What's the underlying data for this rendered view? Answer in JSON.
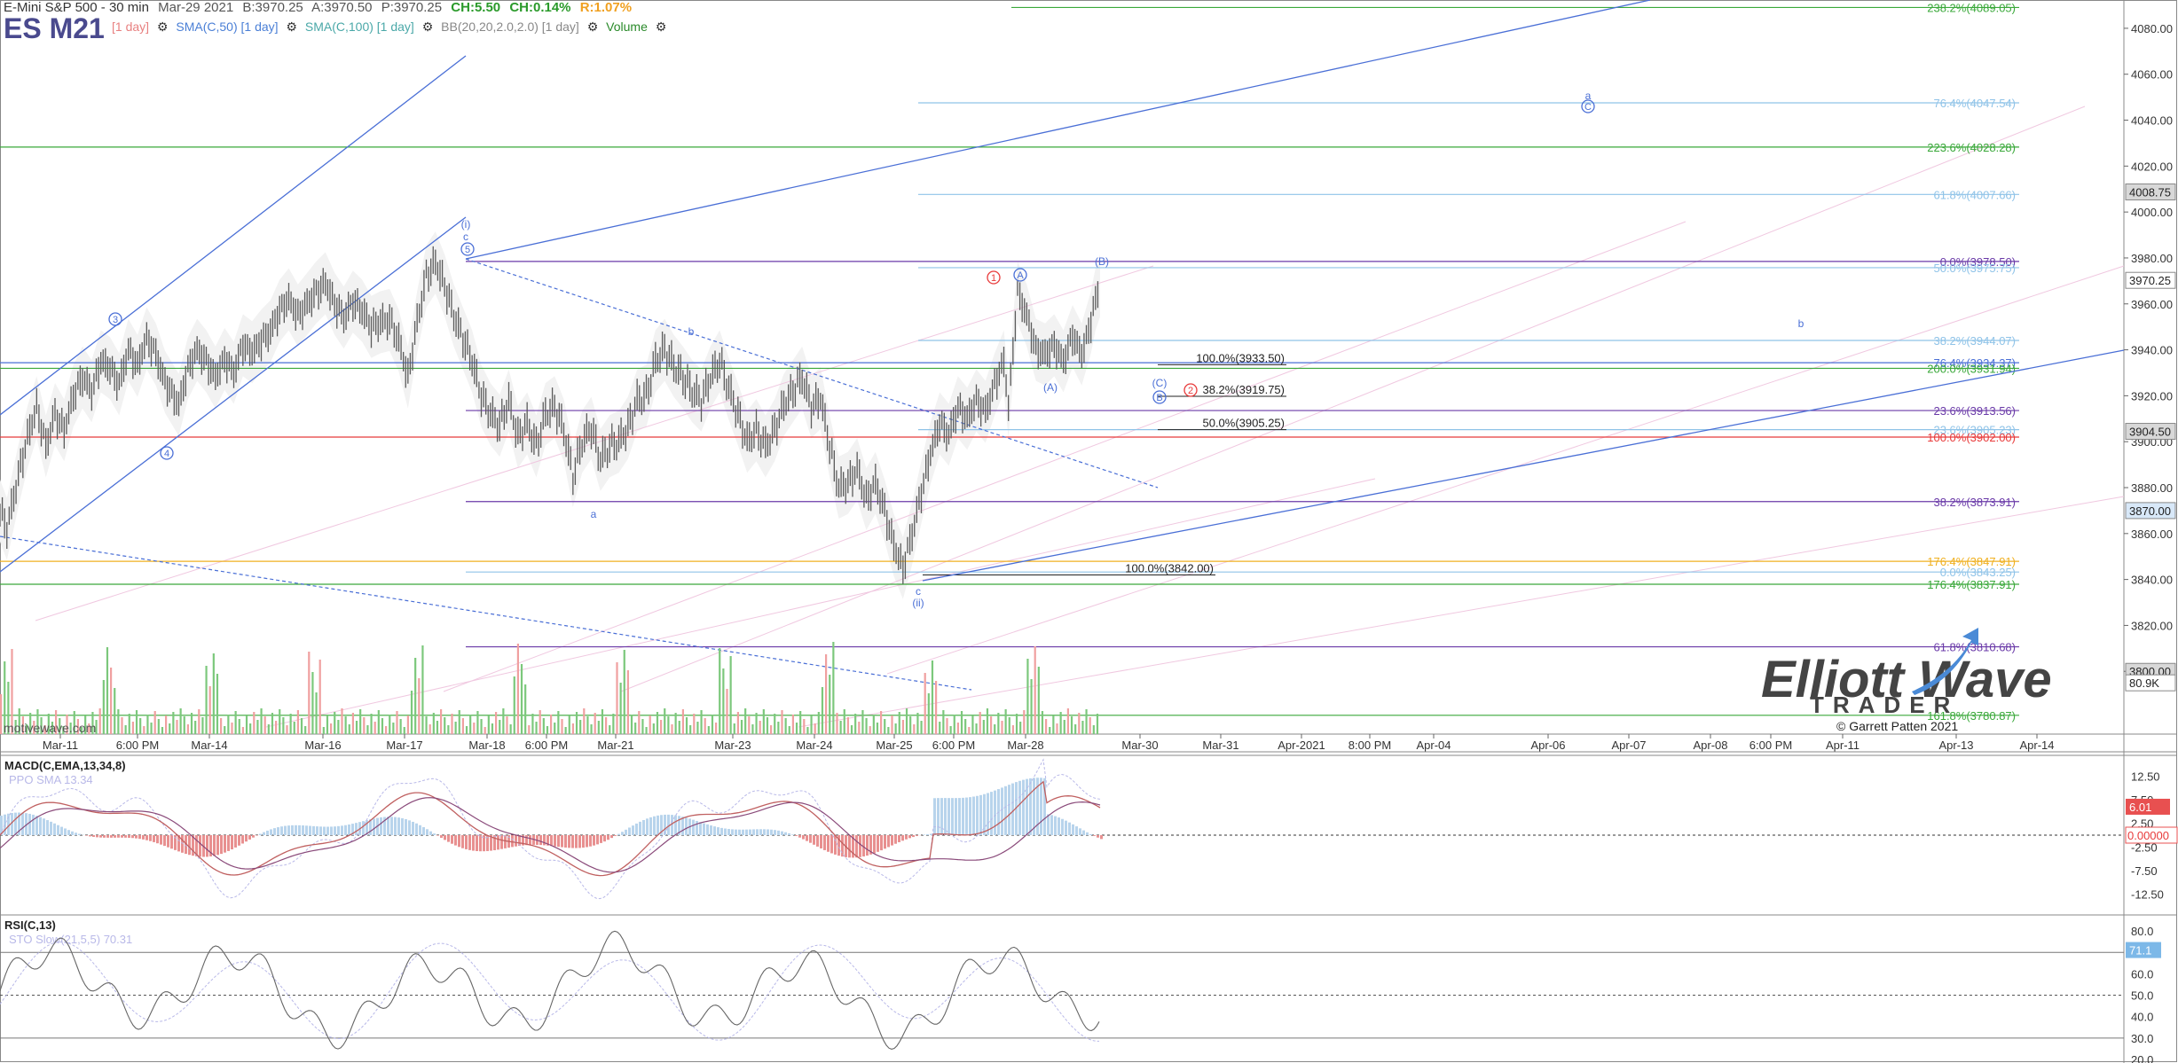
{
  "header": {
    "title": "E-Mini S&P 500 - 30 min",
    "symbol": "ES M21",
    "date": "Mar-29 2021",
    "bid": "B:3970.25",
    "ask": "A:3970.50",
    "price": "P:3970.25",
    "change": "CH:5.50",
    "change_pct": "CH:0.14%",
    "range": "R:1.07%",
    "indicators": [
      {
        "label": "SMA(C,50) [1 day]",
        "color": "#4a7fd6"
      },
      {
        "label": "SMA(C,100) [1 day]",
        "color": "#4aa8a8"
      },
      {
        "label": "BB(20,20,2.0,2.0) [1 day]",
        "color": "#888888"
      },
      {
        "label": "Volume",
        "color": "#2a8a2a"
      }
    ],
    "indicator_prefix": "[1 day]"
  },
  "watermark": "motivewave.com",
  "logo": {
    "line1": "Elliott Wave",
    "line2": "TRADER",
    "copyright": "© Garrett Patten 2021"
  },
  "colors": {
    "price_bar": "#5a5a5a",
    "blue": "#4a6fd6",
    "light_blue": "#8fc3e8",
    "green": "#3aa83a",
    "purple": "#6a3aa8",
    "red": "#e83a3a",
    "orange": "#f0b020",
    "pink": "#e8a0c8"
  },
  "chart_data": [
    {
      "type": "candlestick",
      "name": "price",
      "ylim": [
        3775,
        4090
      ],
      "y_ticks": [
        "4080.00",
        "4060.00",
        "4040.00",
        "4020.00",
        "4000.00",
        "3980.00",
        "3960.00",
        "3940.00",
        "3920.00",
        "3900.00",
        "3880.00",
        "3860.00",
        "3840.00",
        "3820.00",
        "3800.00"
      ],
      "x_ticks": [
        "Mar-11",
        "6:00 PM",
        "Mar-14",
        "Mar-16",
        "Mar-17",
        "Mar-18",
        "6:00 PM",
        "Mar-21",
        "Mar-23",
        "Mar-24",
        "Mar-25",
        "6:00 PM",
        "Mar-28",
        "Mar-30",
        "Mar-31",
        "Apr-2021",
        "8:00 PM",
        "Apr-04",
        "Apr-06",
        "Apr-07",
        "Apr-08",
        "6:00 PM",
        "Apr-11",
        "Apr-13",
        "Apr-14"
      ],
      "price_path": [
        [
          0,
          3870
        ],
        [
          3,
          3862
        ],
        [
          8,
          3885
        ],
        [
          12,
          3902
        ],
        [
          16,
          3915
        ],
        [
          20,
          3898
        ],
        [
          24,
          3912
        ],
        [
          28,
          3905
        ],
        [
          32,
          3920
        ],
        [
          36,
          3928
        ],
        [
          40,
          3922
        ],
        [
          44,
          3935
        ],
        [
          48,
          3932
        ],
        [
          52,
          3925
        ],
        [
          56,
          3940
        ],
        [
          60,
          3933
        ],
        [
          64,
          3945
        ],
        [
          68,
          3938
        ],
        [
          72,
          3926
        ],
        [
          75,
          3921
        ],
        [
          78,
          3916
        ],
        [
          82,
          3932
        ],
        [
          86,
          3940
        ],
        [
          90,
          3935
        ],
        [
          94,
          3928
        ],
        [
          98,
          3936
        ],
        [
          102,
          3930
        ],
        [
          106,
          3942
        ],
        [
          110,
          3939
        ],
        [
          114,
          3944
        ],
        [
          118,
          3948
        ],
        [
          122,
          3957
        ],
        [
          126,
          3962
        ],
        [
          130,
          3955
        ],
        [
          134,
          3960
        ],
        [
          138,
          3965
        ],
        [
          142,
          3969
        ],
        [
          146,
          3960
        ],
        [
          150,
          3954
        ],
        [
          154,
          3961
        ],
        [
          158,
          3957
        ],
        [
          162,
          3950
        ],
        [
          166,
          3952
        ],
        [
          170,
          3953
        ],
        [
          174,
          3944
        ],
        [
          178,
          3928
        ],
        [
          182,
          3952
        ],
        [
          186,
          3972
        ],
        [
          190,
          3978
        ],
        [
          194,
          3968
        ],
        [
          198,
          3955
        ],
        [
          202,
          3945
        ],
        [
          206,
          3935
        ],
        [
          210,
          3920
        ],
        [
          214,
          3912
        ],
        [
          218,
          3907
        ],
        [
          222,
          3918
        ],
        [
          226,
          3902
        ],
        [
          230,
          3908
        ],
        [
          234,
          3898
        ],
        [
          238,
          3912
        ],
        [
          242,
          3915
        ],
        [
          246,
          3905
        ],
        [
          250,
          3885
        ],
        [
          254,
          3900
        ],
        [
          258,
          3906
        ],
        [
          262,
          3892
        ],
        [
          266,
          3898
        ],
        [
          270,
          3900
        ],
        [
          274,
          3906
        ],
        [
          278,
          3918
        ],
        [
          282,
          3920
        ],
        [
          286,
          3935
        ],
        [
          290,
          3940
        ],
        [
          294,
          3933
        ],
        [
          298,
          3928
        ],
        [
          302,
          3922
        ],
        [
          306,
          3918
        ],
        [
          310,
          3928
        ],
        [
          314,
          3935
        ],
        [
          318,
          3923
        ],
        [
          322,
          3912
        ],
        [
          326,
          3900
        ],
        [
          330,
          3905
        ],
        [
          334,
          3898
        ],
        [
          338,
          3905
        ],
        [
          342,
          3916
        ],
        [
          346,
          3922
        ],
        [
          350,
          3928
        ],
        [
          354,
          3915
        ],
        [
          358,
          3919
        ],
        [
          362,
          3898
        ],
        [
          366,
          3880
        ],
        [
          370,
          3882
        ],
        [
          374,
          3888
        ],
        [
          378,
          3875
        ],
        [
          382,
          3882
        ],
        [
          386,
          3870
        ],
        [
          390,
          3855
        ],
        [
          394,
          3845
        ],
        [
          398,
          3860
        ],
        [
          402,
          3878
        ],
        [
          406,
          3895
        ],
        [
          410,
          3908
        ],
        [
          414,
          3903
        ],
        [
          418,
          3915
        ],
        [
          422,
          3910
        ],
        [
          426,
          3918
        ],
        [
          430,
          3913
        ],
        [
          434,
          3925
        ],
        [
          438,
          3935
        ],
        [
          440,
          3915
        ],
        [
          444,
          3965
        ],
        [
          448,
          3955
        ],
        [
          452,
          3940
        ],
        [
          456,
          3938
        ],
        [
          460,
          3942
        ],
        [
          464,
          3935
        ],
        [
          468,
          3946
        ],
        [
          472,
          3938
        ],
        [
          476,
          3952
        ],
        [
          478,
          3962
        ],
        [
          480,
          3968
        ]
      ]
    },
    {
      "type": "line",
      "name": "MACD(C,EMA,13,34,8)",
      "ylim": [
        -15,
        15
      ],
      "y_ticks": [
        "12.50",
        "7.50",
        "2.50",
        "-2.50",
        "-7.50",
        "-12.50"
      ],
      "series": [
        {
          "name": "PPO SMA 13.34"
        }
      ],
      "last_values": [
        "6.01",
        "0.00000"
      ]
    },
    {
      "type": "line",
      "name": "RSI(C,13)",
      "ylim": [
        20,
        85
      ],
      "y_ticks": [
        "80.0",
        "70.0",
        "60.0",
        "50.0",
        "40.0",
        "30.0",
        "20.0"
      ],
      "series": [
        {
          "name": "STO Slow(21,5,5) 70.31"
        }
      ],
      "last_values": [
        "71.1"
      ]
    }
  ],
  "levels": [
    {
      "label": "238.2%(4089.05)",
      "value": 4089.05,
      "color": "#3aa83a"
    },
    {
      "label": "76.4%(4047.54)",
      "value": 4047.54,
      "color": "#8fc3e8"
    },
    {
      "label": "223.6%(4028.28)",
      "value": 4028.28,
      "color": "#3aa83a"
    },
    {
      "label": "61.8%(4007.66)",
      "value": 4007.66,
      "color": "#8fc3e8"
    },
    {
      "label": "0.0%(3978.50)",
      "value": 3978.5,
      "color": "#6a3aa8"
    },
    {
      "label": "50.0%(3975.75)",
      "value": 3975.75,
      "color": "#8fc3e8"
    },
    {
      "label": "38.2%(3944.07)",
      "value": 3944.07,
      "color": "#8fc3e8"
    },
    {
      "label": "76.4%(3934.37)",
      "value": 3934.37,
      "color": "#4a6fd6"
    },
    {
      "label": "200.0%(3931.94)",
      "value": 3931.94,
      "color": "#3aa83a"
    },
    {
      "label": "23.6%(3913.56)",
      "value": 3913.56,
      "color": "#6a3aa8"
    },
    {
      "label": "23.6%(3905.23)",
      "value": 3905.23,
      "color": "#8fc3e8"
    },
    {
      "label": "100.0%(3902.00)",
      "value": 3902.0,
      "color": "#e83a3a"
    },
    {
      "label": "38.2%(3873.91)",
      "value": 3873.91,
      "color": "#6a3aa8"
    },
    {
      "label": "176.4%(3847.91)",
      "value": 3847.91,
      "color": "#f0b020"
    },
    {
      "label": "0.0%(3843.25)",
      "value": 3843.25,
      "color": "#8fc3e8"
    },
    {
      "label": "176.4%(3837.91)",
      "value": 3837.91,
      "color": "#3aa83a"
    },
    {
      "label": "61.8%(3810.68)",
      "value": 3810.68,
      "color": "#6a3aa8"
    },
    {
      "label": "161.8%(3780.87)",
      "value": 3780.87,
      "color": "#3aa83a"
    }
  ],
  "mid_levels": [
    {
      "label": "100.0%(3933.50)",
      "value": 3933.5
    },
    {
      "label": "38.2%(3919.75)",
      "value": 3919.75
    },
    {
      "label": "50.0%(3905.25)",
      "value": 3905.25
    },
    {
      "label": "100.0%(3842.00)",
      "value": 3842.0
    }
  ],
  "price_axis_badges": [
    {
      "text": "4008.75",
      "value": 4008.75,
      "bg": "#d8d8d8"
    },
    {
      "text": "3970.25",
      "value": 3970.25,
      "bg": "#ffffff"
    },
    {
      "text": "3904.50",
      "value": 3904.5,
      "bg": "#d8d8d8"
    },
    {
      "text": "3870.00",
      "value": 3870.0,
      "bg": "#d8e8f8"
    },
    {
      "text": "3800.00",
      "value": 3800.0,
      "bg": "#d8d8d8"
    },
    {
      "text": "80.9K",
      "value": 3795.0,
      "bg": "#ffffff"
    }
  ],
  "wave_labels": [
    {
      "text": "3",
      "style": "circle",
      "color": "#4a6fd6"
    },
    {
      "text": "4",
      "style": "circle",
      "color": "#4a6fd6"
    },
    {
      "text": "(i)",
      "style": "plain",
      "color": "#4a6fd6"
    },
    {
      "text": "c",
      "style": "plain",
      "color": "#4a6fd6"
    },
    {
      "text": "5",
      "style": "circle",
      "color": "#4a6fd6"
    },
    {
      "text": "b",
      "style": "plain",
      "color": "#4a6fd6"
    },
    {
      "text": "a",
      "style": "plain",
      "color": "#4a6fd6"
    },
    {
      "text": "c",
      "style": "plain",
      "color": "#4a6fd6"
    },
    {
      "text": "(ii)",
      "style": "plain",
      "color": "#4a6fd6"
    },
    {
      "text": "1",
      "style": "circle",
      "color": "#e83a3a"
    },
    {
      "text": "A",
      "style": "circle",
      "color": "#4a6fd6"
    },
    {
      "text": "(A)",
      "style": "plain",
      "color": "#4a6fd6"
    },
    {
      "text": "(B)",
      "style": "plain",
      "color": "#4a6fd6"
    },
    {
      "text": "(C)",
      "style": "plain",
      "color": "#4a6fd6"
    },
    {
      "text": "B",
      "style": "circle",
      "color": "#4a6fd6"
    },
    {
      "text": "2",
      "style": "circle",
      "color": "#e83a3a"
    },
    {
      "text": "a",
      "style": "plain",
      "color": "#4a6fd6"
    },
    {
      "text": "C",
      "style": "circle",
      "color": "#4a6fd6"
    },
    {
      "text": "b",
      "style": "plain",
      "color": "#4a6fd6"
    }
  ]
}
